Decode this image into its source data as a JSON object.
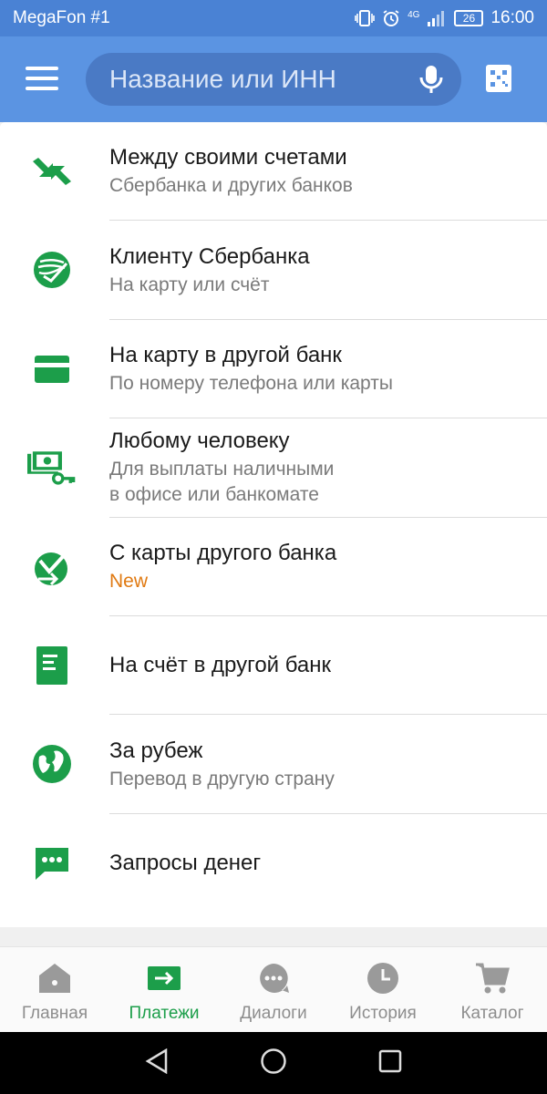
{
  "status_bar": {
    "carrier": "MegaFon #1",
    "network": "4G",
    "battery": "26",
    "time": "16:00"
  },
  "header": {
    "search_placeholder": "Название или ИНН"
  },
  "colors": {
    "header_bg": "#5b94e2",
    "status_bg": "#4a82d4",
    "brand_green": "#1c9e4a",
    "new_badge": "#e07a12"
  },
  "transfers": {
    "items": [
      {
        "title": "Между своими счетами",
        "subtitle": "Сбербанка и других банков",
        "icon": "accounts-transfer-icon"
      },
      {
        "title": "Клиенту Сбербанка",
        "subtitle": "На карту или счёт",
        "icon": "sberbank-logo-icon"
      },
      {
        "title": "На карту в другой банк",
        "subtitle": "По номеру телефона или карты",
        "icon": "card-icon"
      },
      {
        "title": "Любому человеку",
        "subtitle": "Для выплаты наличными",
        "subtitle2": "в офисе или банкомате",
        "icon": "cash-key-icon"
      },
      {
        "title": "С карты другого банка",
        "subtitle": "New",
        "icon": "incoming-transfer-icon"
      },
      {
        "title": "На счёт в другой банк",
        "subtitle": "",
        "icon": "document-icon"
      },
      {
        "title": "За рубеж",
        "subtitle": "Перевод в другую страну",
        "icon": "globe-icon"
      },
      {
        "title": "Запросы денег",
        "subtitle": "",
        "icon": "chat-request-icon"
      }
    ]
  },
  "bottom_nav": {
    "items": [
      {
        "label": "Главная",
        "icon": "home-icon"
      },
      {
        "label": "Платежи",
        "icon": "payments-icon",
        "active": true
      },
      {
        "label": "Диалоги",
        "icon": "dialogs-icon"
      },
      {
        "label": "История",
        "icon": "history-icon"
      },
      {
        "label": "Каталог",
        "icon": "cart-icon"
      }
    ]
  }
}
